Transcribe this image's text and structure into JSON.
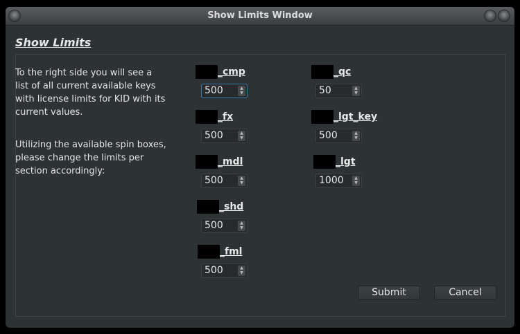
{
  "window": {
    "title": "Show Limits Window"
  },
  "heading": "Show Limits",
  "description": [
    "To the right side you will see a list of all current available keys with license limits for KID with its current values.",
    "Utilizing the available spin boxes, please change the limits per section accordingly:"
  ],
  "limits": [
    {
      "key": "_cmp",
      "value": "500"
    },
    {
      "key": "_fx",
      "value": "500"
    },
    {
      "key": "_mdl",
      "value": "500"
    },
    {
      "key": "_shd",
      "value": "500"
    },
    {
      "key": "_fml",
      "value": "500"
    },
    {
      "key": "_qc",
      "value": "50"
    },
    {
      "key": "_lgt_key",
      "value": "500"
    },
    {
      "key": "_lgt",
      "value": "1000"
    }
  ],
  "buttons": {
    "submit": "Submit",
    "cancel": "Cancel"
  }
}
